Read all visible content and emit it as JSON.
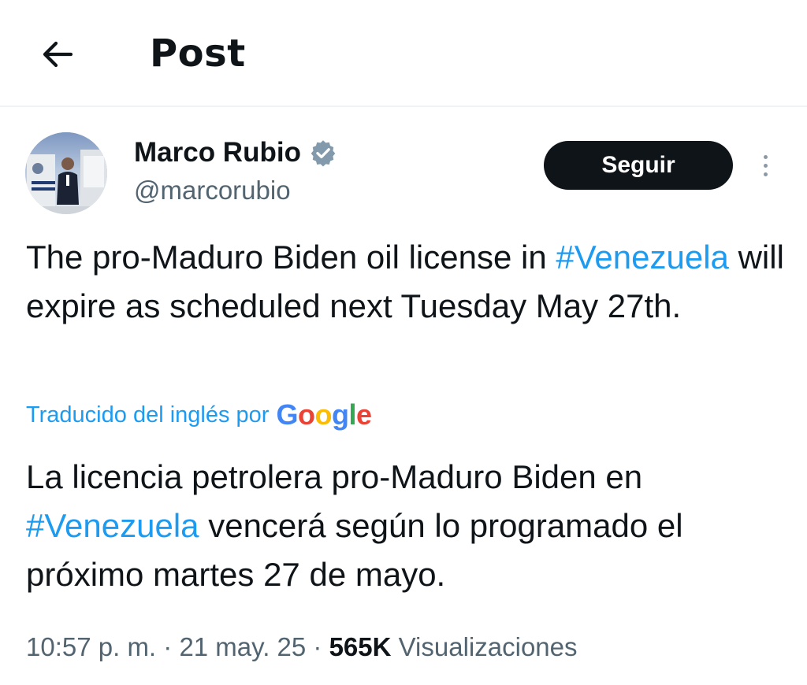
{
  "header": {
    "back_icon": "arrow-left-icon",
    "title": "Post"
  },
  "author": {
    "name": "Marco Rubio",
    "handle": "@marcorubio",
    "verified_icon": "verified-badge-icon",
    "verified_color": "#829aab"
  },
  "actions": {
    "follow_label": "Seguir",
    "more_icon": "more-vertical-icon"
  },
  "tweet": {
    "text_part1": "The pro-Maduro Biden oil  license in ",
    "hashtag": "#Venezuela",
    "text_part2": " will expire as scheduled next Tuesday May 27th."
  },
  "translation": {
    "label": "Traducido del inglés por",
    "provider_letters": [
      "G",
      "o",
      "o",
      "g",
      "l",
      "e"
    ],
    "provider_colors": [
      "#4285f4",
      "#ea4335",
      "#fbbc05",
      "#4285f4",
      "#34a853",
      "#ea4335"
    ],
    "text_part1": "La licencia petrolera pro-Maduro Biden en ",
    "hashtag": "#Venezuela",
    "text_part2": " vencerá según lo programado el próximo martes 27 de mayo."
  },
  "meta": {
    "time": "10:57 p. m.",
    "separator": " · ",
    "date": "21 may. 25",
    "views_count": "565K",
    "views_label": "Visualizaciones"
  },
  "colors": {
    "accent": "#1d9bf0",
    "text_primary": "#0f1419",
    "text_secondary": "#536471",
    "button_bg": "#0f1419"
  }
}
